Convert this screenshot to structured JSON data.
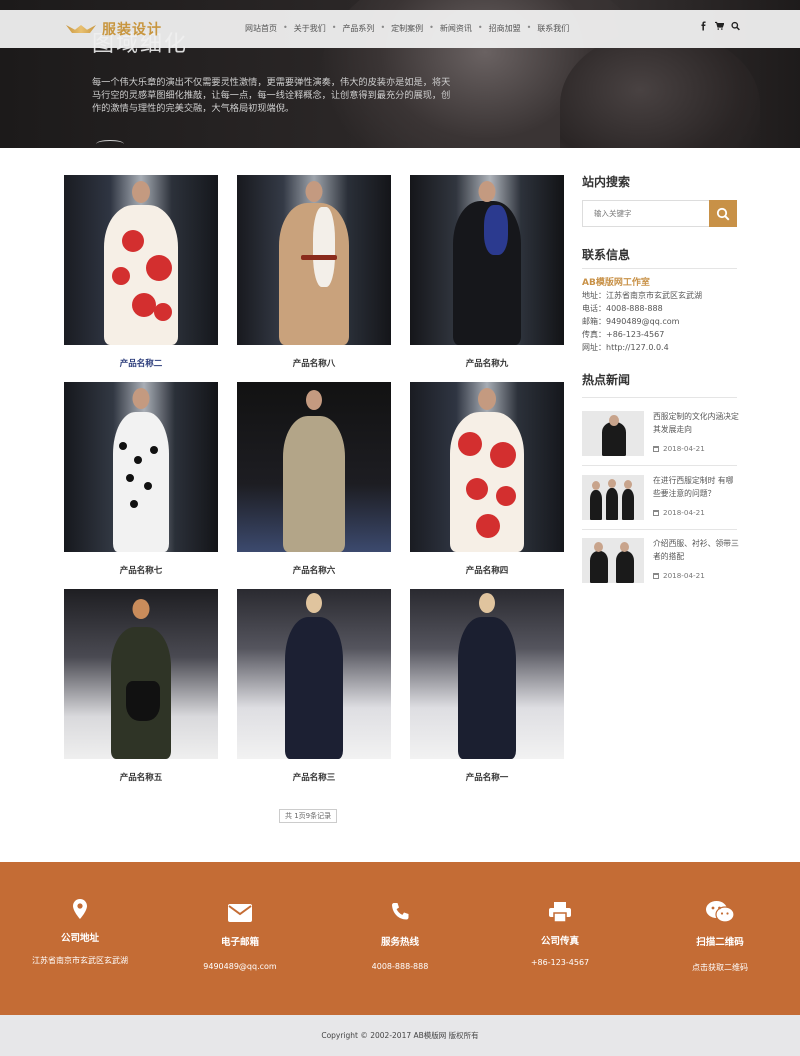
{
  "header": {
    "logo_text": "服装设计",
    "nav": [
      "网站首页",
      "关于我们",
      "产品系列",
      "定制案例",
      "新闻资讯",
      "招商加盟",
      "联系我们"
    ],
    "nav_separator": "•",
    "icons": [
      "facebook-icon",
      "cart-icon",
      "search-icon"
    ]
  },
  "hero": {
    "title": "图域细化",
    "text": "每一个伟大乐章的演出不仅需要灵性激情，更需要弹性演奏，伟大的皮装亦是如是，将天马行空的灵感草图细化推敲，让每一点，每一线诠释概念，让创意得到最充分的展现，创作的激情与理性的完美交融，大气格局初现端倪。"
  },
  "products": [
    {
      "name": "产品名称二",
      "active": true
    },
    {
      "name": "产品名称八",
      "active": false
    },
    {
      "name": "产品名称九",
      "active": false
    },
    {
      "name": "产品名称七",
      "active": false
    },
    {
      "name": "产品名称六",
      "active": false
    },
    {
      "name": "产品名称四",
      "active": false
    },
    {
      "name": "产品名称五",
      "active": false
    },
    {
      "name": "产品名称三",
      "active": false
    },
    {
      "name": "产品名称一",
      "active": false
    }
  ],
  "pagination": {
    "text": "共 1页9条记录"
  },
  "sidebar": {
    "search_title": "站内搜索",
    "search_placeholder": "输入关键字",
    "contact_title": "联系信息",
    "company": "AB模版网工作室",
    "contact_lines": [
      "地址：江苏省南京市玄武区玄武湖",
      "电话：4008-888-888",
      "邮箱：9490489@qq.com",
      "传真：+86-123-4567",
      "网址：http://127.0.0.4"
    ],
    "news_title": "热点新闻",
    "news": [
      {
        "title": "西服定制的文化内涵决定其发展走向",
        "date": "2018-04-21"
      },
      {
        "title": "在进行西服定制时 有哪些要注意的问题？",
        "date": "2018-04-21"
      },
      {
        "title": "介绍西服、衬衫、领带三者的搭配",
        "date": "2018-04-21"
      }
    ]
  },
  "footer": {
    "columns": [
      {
        "icon": "location-pin-icon",
        "title": "公司地址",
        "text": "江苏省南京市玄武区玄武湖"
      },
      {
        "icon": "envelope-icon",
        "title": "电子邮箱",
        "text": "9490489@qq.com"
      },
      {
        "icon": "phone-icon",
        "title": "服务热线",
        "text": "4008-888-888"
      },
      {
        "icon": "printer-icon",
        "title": "公司传真",
        "text": "+86-123-4567"
      },
      {
        "icon": "wechat-icon",
        "title": "扫描二维码",
        "text": "点击获取二维码"
      }
    ],
    "copyright": "Copyright © 2002-2017 AB模版网 版权所有"
  },
  "colors": {
    "accent": "#c89147",
    "footer_band": "#c46c35",
    "active_link": "#2a3b7a"
  }
}
